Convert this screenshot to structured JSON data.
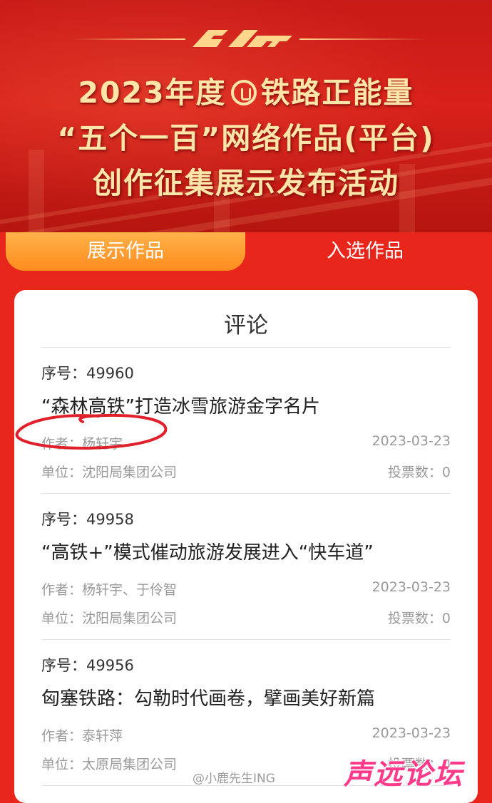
{
  "banner": {
    "logo_text": "",
    "title_lines": [
      {
        "before": "2023年度",
        "after": "铁路正能量"
      },
      "“五个一百”网络作品(平台)",
      "创作征集展示发布活动"
    ]
  },
  "tabs": [
    {
      "label": "展示作品",
      "active": true
    },
    {
      "label": "入选作品",
      "active": false
    }
  ],
  "card": {
    "title": "评论",
    "items": [
      {
        "serial": "序号：49960",
        "headline": "“森林高铁”打造冰雪旅游金字名片",
        "author": "作者：杨轩宇",
        "date": "2023-03-23",
        "unit": "单位：沈阳局集团公司",
        "votes": "投票数：0"
      },
      {
        "serial": "序号：49958",
        "headline": "“高铁+”模式催动旅游发展进入“快车道”",
        "author": "作者：杨轩宇、于伶智",
        "date": "2023-03-23",
        "unit": "单位：沈阳局集团公司",
        "votes": "投票数：0"
      },
      {
        "serial": "序号：49956",
        "headline": "匈塞铁路：勾勒时代画卷，擘画美好新篇",
        "author": "作者：泰轩萍",
        "date": "2023-03-23",
        "unit": "单位：太原局集团公司",
        "votes": "投票数：0"
      }
    ]
  },
  "watermarks": {
    "weibo": "@小鹿先生ING",
    "forum": "声远论坛"
  },
  "colors": {
    "background_red": "#e8261c",
    "tab_active": "#ff9a2e",
    "title_gold": "#ffe6a8",
    "annotation_circle": "#e0202a"
  }
}
